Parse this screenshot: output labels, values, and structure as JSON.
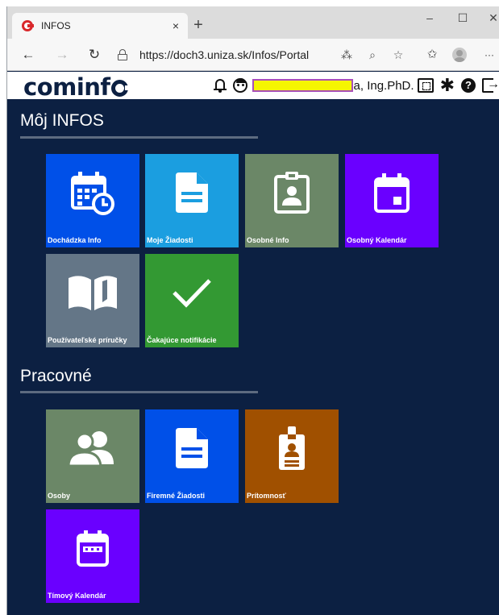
{
  "browser": {
    "tab_title": "INFOS",
    "tab_close": "×",
    "new_tab": "+",
    "window_controls": {
      "minimize": "–",
      "maximize": "☐",
      "close": "✕"
    },
    "nav": {
      "back": "←",
      "forward": "→",
      "reload": "↻",
      "more": "···"
    },
    "url": "https://doch3.uniza.sk/Infos/Portal"
  },
  "header": {
    "logo_prefix": "cominf",
    "username_suffix": "a, Ing.PhD.",
    "help_glyph": "?",
    "gear_glyph": "✱",
    "logout_glyph": "→"
  },
  "sections": [
    {
      "title": "Môj INFOS",
      "tiles": [
        {
          "label": "Dochádzka Info",
          "color": "#0050e8",
          "icon": "calendar-clock-icon"
        },
        {
          "label": "Moje Žiadosti",
          "color": "#1b9ee0",
          "icon": "document-icon"
        },
        {
          "label": "Osobné Info",
          "color": "#6b8767",
          "icon": "id-badge-icon"
        },
        {
          "label": "Osobný Kalendár",
          "color": "#6a00ff",
          "icon": "calendar-icon"
        },
        {
          "label": "Používateľské príručky",
          "color": "#647687",
          "icon": "book-icon"
        },
        {
          "label": "Čakajúce notifikácie",
          "color": "#339933",
          "icon": "checkmark-icon"
        }
      ]
    },
    {
      "title": "Pracovné",
      "tiles": [
        {
          "label": "Osoby",
          "color": "#6b8767",
          "icon": "people-icon"
        },
        {
          "label": "Firemné Žiadosti",
          "color": "#0050e8",
          "icon": "document-icon"
        },
        {
          "label": "Prítomnosť",
          "color": "#a05000",
          "icon": "name-badge-icon"
        },
        {
          "label": "Tímový Kalendár",
          "color": "#6a00ff",
          "icon": "calendar-dots-icon"
        }
      ]
    }
  ]
}
